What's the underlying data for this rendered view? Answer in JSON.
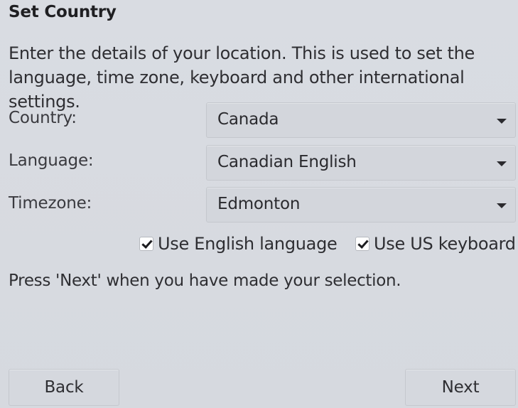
{
  "dialog": {
    "title": "Set Country",
    "intro": "Enter the details of your location. This is used to set the language, time zone, keyboard and other international settings.",
    "fields": {
      "country": {
        "label": "Country:",
        "value": "Canada"
      },
      "language": {
        "label": "Language:",
        "value": "Canadian English"
      },
      "timezone": {
        "label": "Timezone:",
        "value": "Edmonton"
      }
    },
    "checkboxes": {
      "english": {
        "label": "Use English language",
        "checked": true
      },
      "us_keyboard": {
        "label": "Use US keyboard",
        "checked": true
      }
    },
    "footer_text": "Press 'Next' when you have made your selection.",
    "buttons": {
      "back": "Back",
      "next": "Next"
    }
  }
}
